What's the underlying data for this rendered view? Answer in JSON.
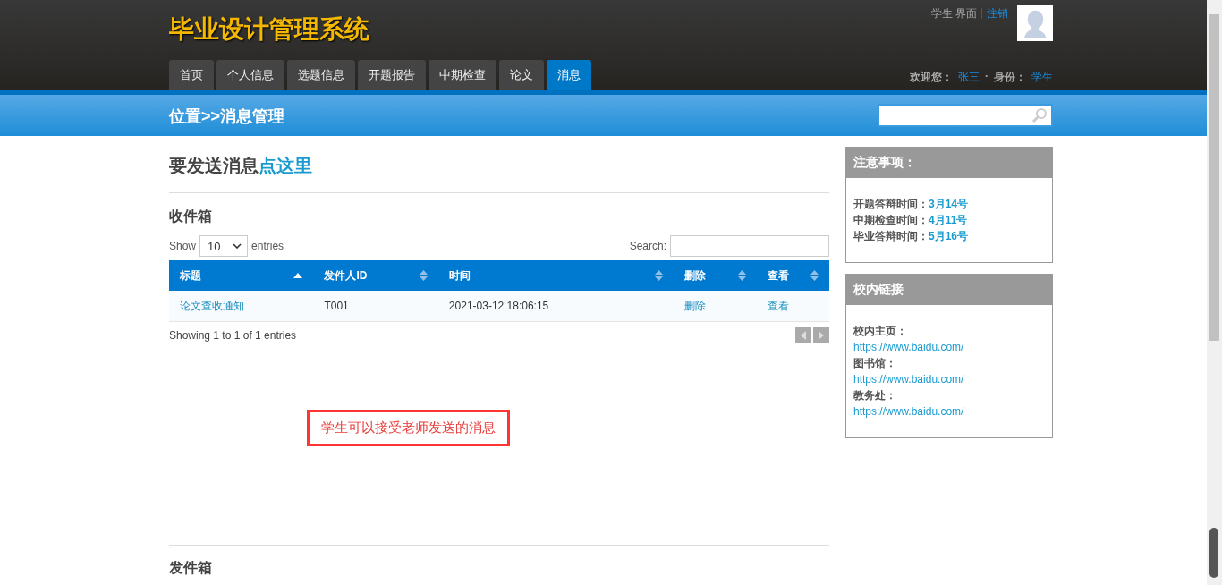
{
  "header": {
    "logo": "毕业设计管理系统",
    "role_label": "学生 界面",
    "separator": "|",
    "logout": "注销",
    "dot": "·",
    "welcome_label": "欢迎您：",
    "user_name": "张三",
    "identity_label": "身份：",
    "identity": "学生"
  },
  "nav": [
    {
      "label": "首页",
      "selected": false
    },
    {
      "label": "个人信息",
      "selected": false
    },
    {
      "label": "选题信息",
      "selected": false
    },
    {
      "label": "开题报告",
      "selected": false
    },
    {
      "label": "中期检查",
      "selected": false
    },
    {
      "label": "论文",
      "selected": false
    },
    {
      "label": "消息",
      "selected": true
    }
  ],
  "breadcrumb": "位置>>消息管理",
  "send_prompt": {
    "text": "要发送消息",
    "link": "点这里"
  },
  "inbox": {
    "title": "收件箱",
    "show_label": "Show",
    "page_size": "10",
    "entries_label": "entries",
    "search_label": "Search:",
    "columns": [
      {
        "label": "标题",
        "sorted": true
      },
      {
        "label": "发件人ID",
        "sorted": false
      },
      {
        "label": "时间",
        "sorted": false
      },
      {
        "label": "删除",
        "sorted": false
      },
      {
        "label": "查看",
        "sorted": false
      }
    ],
    "rows": [
      {
        "title": "论文查收通知",
        "sender": "T001",
        "time": "2021-03-12 18:06:15",
        "delete": "删除",
        "view": "查看"
      }
    ],
    "info": "Showing 1 to 1 of 1 entries"
  },
  "annotation": "学生可以接受老师发送的消息",
  "outbox": {
    "title": "发件箱"
  },
  "notices": {
    "title": "注意事项：",
    "items": [
      {
        "label": "开题答辩时间：",
        "value": "3月14号"
      },
      {
        "label": "中期检查时间：",
        "value": "4月11号"
      },
      {
        "label": "毕业答辩时间：",
        "value": "5月16号"
      }
    ]
  },
  "links": {
    "title": "校内链接",
    "items": [
      {
        "label": "校内主页：",
        "url": "https://www.baidu.com/"
      },
      {
        "label": "图书馆：",
        "url": "https://www.baidu.com/"
      },
      {
        "label": "教务处：",
        "url": "https://www.baidu.com/"
      }
    ]
  }
}
